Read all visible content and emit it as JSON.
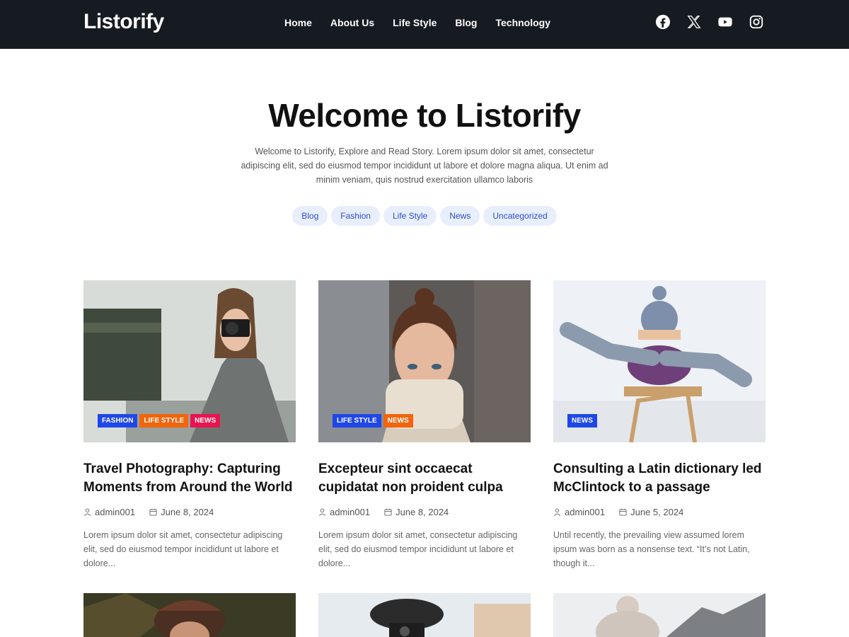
{
  "header": {
    "logo": "Listorify",
    "nav": [
      "Home",
      "About Us",
      "Life Style",
      "Blog",
      "Technology"
    ],
    "social_icons": [
      "facebook-icon",
      "x-twitter-icon",
      "youtube-icon",
      "instagram-icon"
    ]
  },
  "hero": {
    "title": "Welcome to Listorify",
    "description": "Welcome to Listorify, Explore and Read Story. Lorem ipsum dolor sit amet, consectetur adipiscing elit, sed do eiusmod tempor incididunt ut labore et dolore magna aliqua. Ut enim ad minim veniam, quis nostrud exercitation ullamco laboris",
    "tags": [
      "Blog",
      "Fashion",
      "Life Style",
      "News",
      "Uncategorized"
    ]
  },
  "posts": [
    {
      "badges": [
        "FASHION",
        "LIFE STYLE",
        "NEWS"
      ],
      "title": "Travel Photography: Capturing Moments from Around the World",
      "author": "admin001",
      "date": "June 8, 2024",
      "excerpt": "Lorem ipsum dolor sit amet, consectetur adipiscing elit, sed do eiusmod tempor incididunt ut labore et dolore..."
    },
    {
      "badges": [
        "LIFE STYLE",
        "NEWS"
      ],
      "title": "Excepteur sint occaecat cupidatat non proident culpa",
      "author": "admin001",
      "date": "June 8, 2024",
      "excerpt": "Lorem ipsum dolor sit amet, consectetur adipiscing elit, sed do eiusmod tempor incididunt ut labore et dolore..."
    },
    {
      "badges": [
        "NEWS"
      ],
      "title": "Consulting a Latin dictionary led McClintock to a passage",
      "author": "admin001",
      "date": "June 5, 2024",
      "excerpt": "Until recently, the prevailing view assumed lorem ipsum was born as a nonsense text. “It’s not Latin, though it..."
    }
  ],
  "colors": {
    "header_bg": "#161a21",
    "tag_bg": "#e8eefb",
    "tag_text": "#2b50c8",
    "badge_fashion": "#1f47e8",
    "badge_lifestyle": "#f1650c",
    "badge_news": "#ea1350"
  }
}
